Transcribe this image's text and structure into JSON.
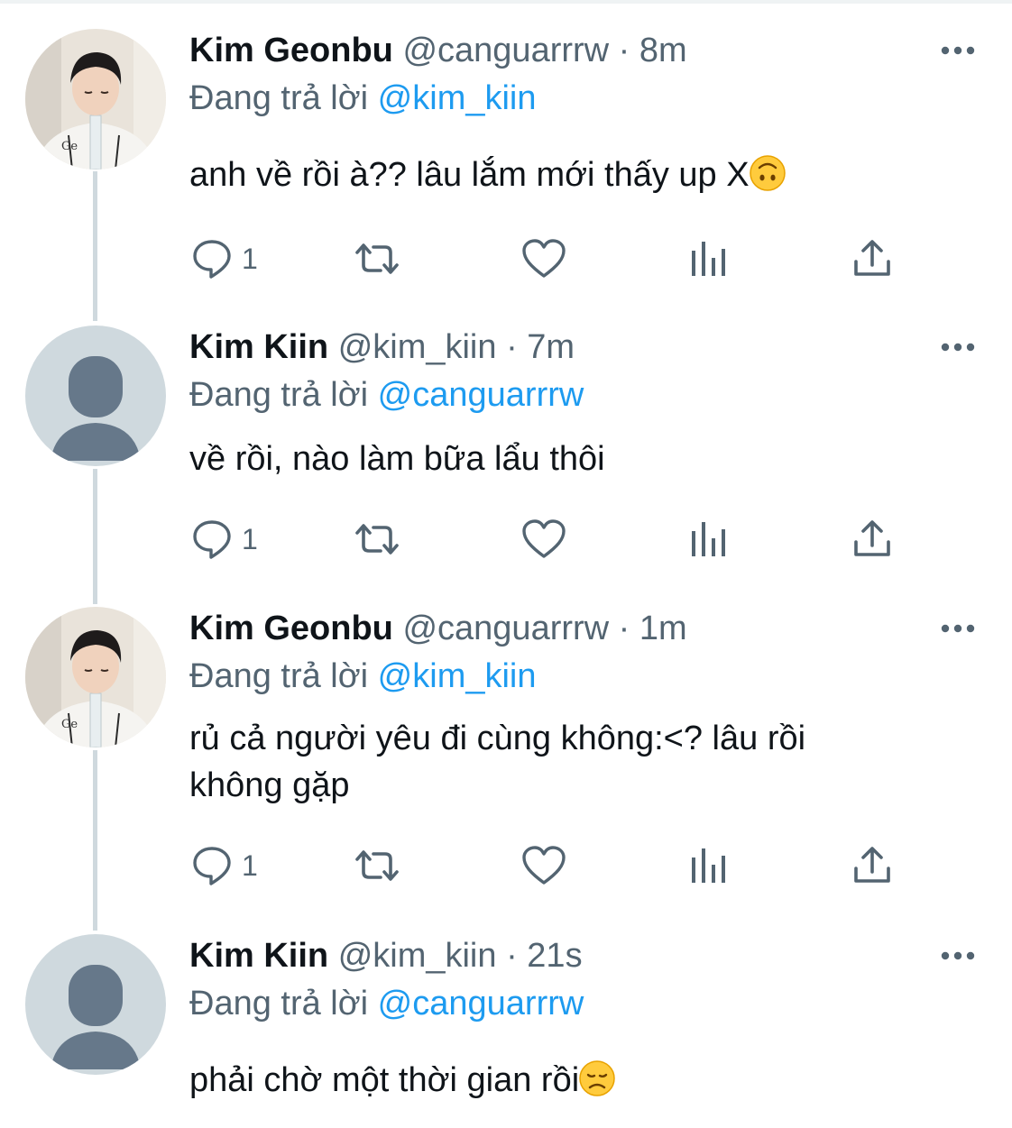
{
  "reply_prefix": "Đang trả lời",
  "tweets": [
    {
      "name": "Kim Geonbu",
      "handle": "@canguarrrw",
      "time": "8m",
      "reply_to": "@kim_kiin",
      "text": "anh về rồi à?? lâu lắm mới thấy up X",
      "emoji": "upside-down-face",
      "avatar": "photo",
      "reply_count": "1"
    },
    {
      "name": "Kim Kiin",
      "handle": "@kim_kiin",
      "time": "7m",
      "reply_to": "@canguarrrw",
      "text": "về rồi, nào làm bữa lẩu thôi",
      "avatar": "default",
      "reply_count": "1"
    },
    {
      "name": "Kim Geonbu",
      "handle": "@canguarrrw",
      "time": "1m",
      "reply_to": "@kim_kiin",
      "text_line1": "rủ cả người yêu đi cùng không:<? lâu rồi",
      "text_line2": "không gặp",
      "avatar": "photo",
      "reply_count": "1"
    },
    {
      "name": "Kim Kiin",
      "handle": "@kim_kiin",
      "time": "21s",
      "reply_to": "@canguarrrw",
      "text": "phải chờ một thời gian rồi",
      "emoji": "disappointed-face",
      "avatar": "default"
    }
  ],
  "colors": {
    "text": "#0f1419",
    "secondary": "#536471",
    "link": "#1d9bf0",
    "thread_line": "#cfd9de",
    "default_avatar_bg": "#cfd9de",
    "default_avatar_fg": "#66788a"
  }
}
